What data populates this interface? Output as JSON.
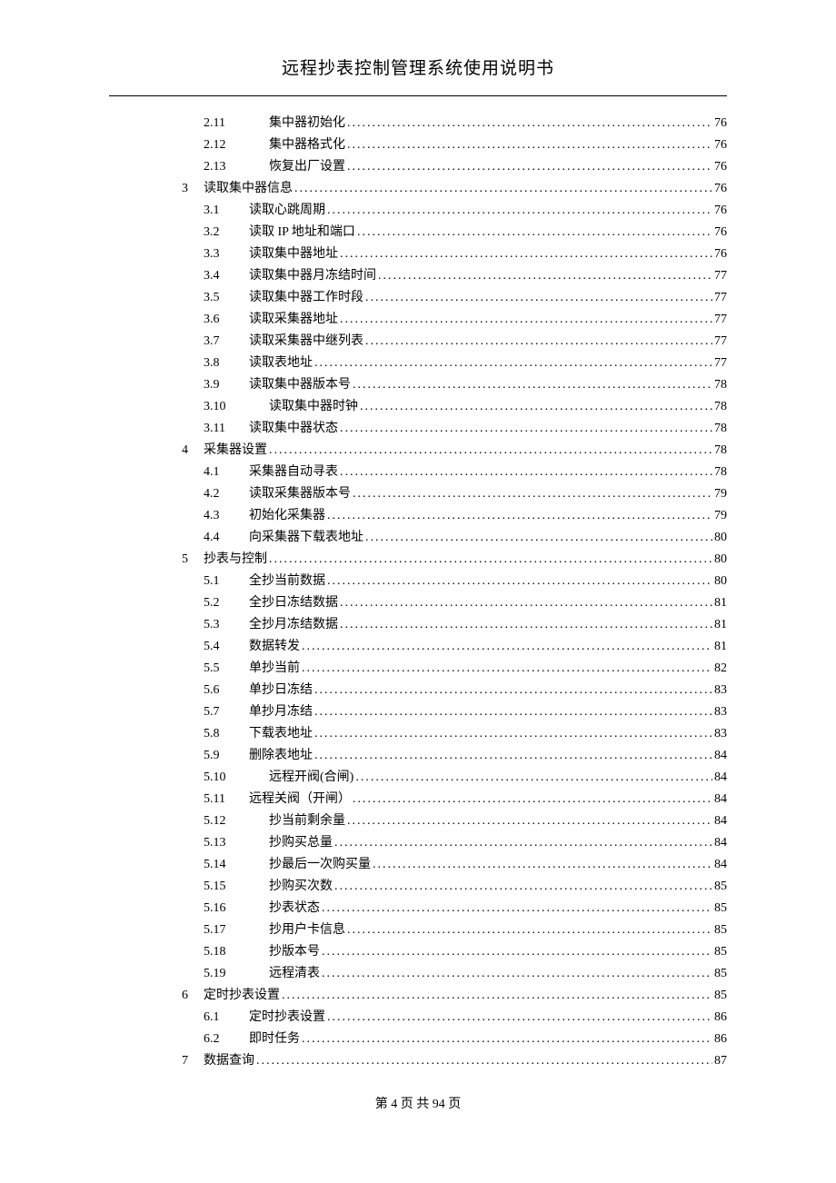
{
  "header_title": "远程抄表控制管理系统使用说明书",
  "footer": {
    "prefix": "第 ",
    "page": "4",
    "middle": " 页 共 ",
    "total": "94",
    "suffix": " 页"
  },
  "toc": [
    {
      "level": 2,
      "num": "2.11",
      "label": "集中器初始化",
      "page": "76",
      "wide": true
    },
    {
      "level": 2,
      "num": "2.12",
      "label": "集中器格式化",
      "page": "76",
      "wide": true
    },
    {
      "level": 2,
      "num": "2.13",
      "label": "恢复出厂设置",
      "page": "76",
      "wide": true
    },
    {
      "level": 1,
      "num": "3",
      "label": "读取集中器信息",
      "page": "76"
    },
    {
      "level": 2,
      "num": "3.1",
      "label": "读取心跳周期",
      "page": "76"
    },
    {
      "level": 2,
      "num": "3.2",
      "label": "读取 IP 地址和端口",
      "page": "76"
    },
    {
      "level": 2,
      "num": "3.3",
      "label": "读取集中器地址",
      "page": "76"
    },
    {
      "level": 2,
      "num": "3.4",
      "label": "读取集中器月冻结时间",
      "page": "77"
    },
    {
      "level": 2,
      "num": "3.5",
      "label": "读取集中器工作时段",
      "page": "77"
    },
    {
      "level": 2,
      "num": "3.6",
      "label": "读取采集器地址",
      "page": "77"
    },
    {
      "level": 2,
      "num": "3.7",
      "label": "读取采集器中继列表",
      "page": "77"
    },
    {
      "level": 2,
      "num": "3.8",
      "label": "读取表地址",
      "page": "77"
    },
    {
      "level": 2,
      "num": "3.9",
      "label": "读取集中器版本号",
      "page": "78"
    },
    {
      "level": 2,
      "num": "3.10",
      "label": "读取集中器时钟",
      "page": "78",
      "wide": true
    },
    {
      "level": 2,
      "num": "3.11",
      "label": "读取集中器状态",
      "page": "78"
    },
    {
      "level": 1,
      "num": "4",
      "label": "采集器设置",
      "page": "78"
    },
    {
      "level": 2,
      "num": "4.1",
      "label": "采集器自动寻表",
      "page": "78"
    },
    {
      "level": 2,
      "num": "4.2",
      "label": "读取采集器版本号",
      "page": "79"
    },
    {
      "level": 2,
      "num": "4.3",
      "label": "初始化采集器",
      "page": "79"
    },
    {
      "level": 2,
      "num": "4.4",
      "label": "向采集器下载表地址",
      "page": "80"
    },
    {
      "level": 1,
      "num": "5",
      "label": "抄表与控制",
      "page": "80"
    },
    {
      "level": 2,
      "num": "5.1",
      "label": "全抄当前数据",
      "page": "80"
    },
    {
      "level": 2,
      "num": "5.2",
      "label": "全抄日冻结数据",
      "page": "81"
    },
    {
      "level": 2,
      "num": "5.3",
      "label": "全抄月冻结数据",
      "page": "81"
    },
    {
      "level": 2,
      "num": "5.4",
      "label": "数据转发",
      "page": "81"
    },
    {
      "level": 2,
      "num": "5.5",
      "label": "单抄当前",
      "page": "82"
    },
    {
      "level": 2,
      "num": "5.6",
      "label": "单抄日冻结",
      "page": "83"
    },
    {
      "level": 2,
      "num": "5.7",
      "label": "单抄月冻结",
      "page": "83"
    },
    {
      "level": 2,
      "num": "5.8",
      "label": "下载表地址",
      "page": "83"
    },
    {
      "level": 2,
      "num": "5.9",
      "label": "删除表地址",
      "page": "84"
    },
    {
      "level": 2,
      "num": "5.10",
      "label": "远程开阀(合闸)",
      "page": "84",
      "wide": true
    },
    {
      "level": 2,
      "num": "5.11",
      "label": "远程关阀（开闸）",
      "page": "84"
    },
    {
      "level": 2,
      "num": "5.12",
      "label": "抄当前剩余量",
      "page": "84",
      "wide": true
    },
    {
      "level": 2,
      "num": "5.13",
      "label": "抄购买总量",
      "page": "84",
      "wide": true
    },
    {
      "level": 2,
      "num": "5.14",
      "label": "抄最后一次购买量",
      "page": "84",
      "wide": true
    },
    {
      "level": 2,
      "num": "5.15",
      "label": "抄购买次数",
      "page": "85",
      "wide": true
    },
    {
      "level": 2,
      "num": "5.16",
      "label": "抄表状态",
      "page": "85",
      "wide": true
    },
    {
      "level": 2,
      "num": "5.17",
      "label": "抄用户卡信息",
      "page": "85",
      "wide": true
    },
    {
      "level": 2,
      "num": "5.18",
      "label": "抄版本号",
      "page": "85",
      "wide": true
    },
    {
      "level": 2,
      "num": "5.19",
      "label": "远程清表",
      "page": "85",
      "wide": true
    },
    {
      "level": 1,
      "num": "6",
      "label": "定时抄表设置",
      "page": "85"
    },
    {
      "level": 2,
      "num": "6.1",
      "label": "定时抄表设置",
      "page": "86"
    },
    {
      "level": 2,
      "num": "6.2",
      "label": "即时任务",
      "page": "86"
    },
    {
      "level": 1,
      "num": "7",
      "label": "数据查询",
      "page": "87"
    }
  ]
}
